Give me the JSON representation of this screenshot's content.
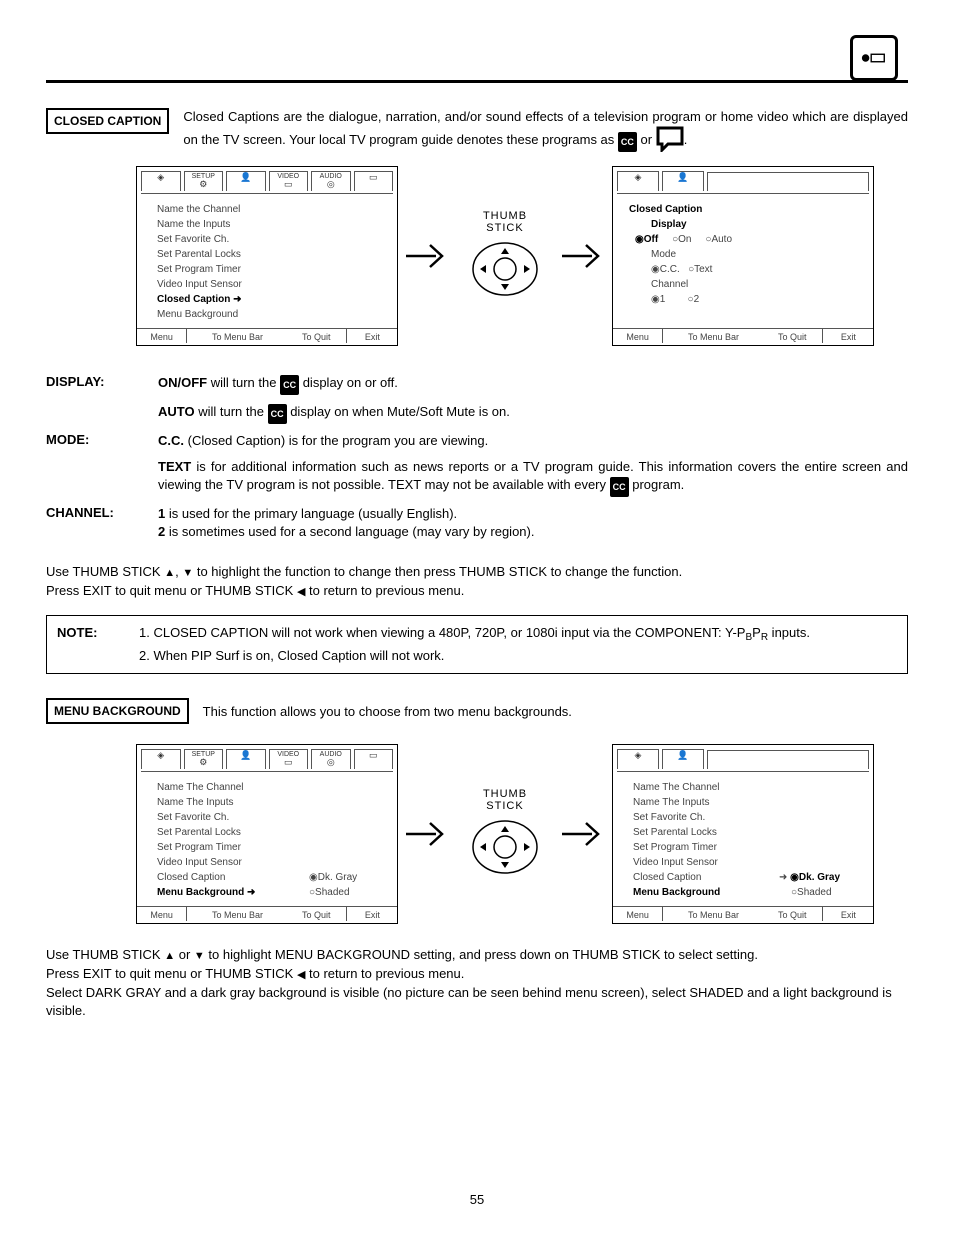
{
  "section1_tag": "CLOSED CAPTION",
  "section1_intro_a": "Closed Captions are the dialogue, narration, and/or sound effects of a television program or home video which are displayed on the TV screen.  Your local TV program guide denotes these programs as ",
  "section1_intro_b": " or ",
  "section1_intro_c": ".",
  "cc": "CC",
  "screen1": {
    "tabs": [
      "SETUP",
      "",
      "VIDEO",
      "AUDIO",
      "",
      ""
    ],
    "items": [
      "Name the Channel",
      "Name the Inputs",
      "Set Favorite Ch.",
      "Set Parental Locks",
      "Set Program Timer",
      "Video Input Sensor",
      "Closed Caption",
      "Menu Background"
    ],
    "footer": [
      "Menu",
      "To Menu Bar",
      "To Quit",
      "Exit"
    ]
  },
  "thumb_label1": "THUMB",
  "thumb_label2": "STICK",
  "screen2": {
    "title": "Closed Caption",
    "group1": "Display",
    "g1": [
      "Off",
      "On",
      "Auto"
    ],
    "group2": "Mode",
    "g2": [
      "C.C.",
      "Text"
    ],
    "group3": "Channel",
    "g3": [
      "1",
      "2"
    ],
    "footer": [
      "Menu",
      "To Menu Bar",
      "To Quit",
      "Exit"
    ]
  },
  "display_label": "DISPLAY:",
  "display_l1a": "ON/OFF",
  "display_l1b": " will turn the ",
  "display_l1c": " display on or off.",
  "display_l2a": "AUTO",
  "display_l2b": " will turn the ",
  "display_l2c": " display on when Mute/Soft Mute is on.",
  "mode_label": "MODE:",
  "mode_l1a": "C.C.",
  "mode_l1b": " (Closed Caption) is for the program you are viewing.",
  "mode_l2a": "TEXT",
  "mode_l2b": " is for additional information such as news reports or a TV program guide.  This information covers the entire screen and viewing the TV program is not possible.  TEXT may not be available with every ",
  "mode_l2c": " program.",
  "channel_label": "CHANNEL:",
  "channel_l1a": "1",
  "channel_l1b": " is used for the primary language (usually English).",
  "channel_l2a": "2",
  "channel_l2b": " is sometimes used for a second language (may vary by region).",
  "inst1a": "Use THUMB STICK ",
  "inst1b": ", ",
  "inst1c": " to highlight the function to change then press THUMB STICK to change the function.",
  "inst2a": "Press EXIT to quit menu or THUMB STICK ",
  "inst2b": " to return to previous menu.",
  "note_hd": "NOTE:",
  "note1a": "1.  CLOSED CAPTION will not work when viewing a 480P, 720P, or 1080i input via the COMPONENT: Y-P",
  "note1b": "B",
  "note1c": "P",
  "note1d": "R",
  "note1e": " inputs.",
  "note2": "2.  When PIP Surf is on, Closed Caption will not work.",
  "section2_tag": "MENU BACKGROUND",
  "section2_intro": "This function allows you to choose from two menu backgrounds.",
  "screen3": {
    "items": [
      "Name The Channel",
      "Name The Inputs",
      "Set Favorite Ch.",
      "Set Parental Locks",
      "Set Program Timer",
      "Video Input Sensor",
      "Closed Caption",
      "Menu Background"
    ],
    "opt1": "Dk. Gray",
    "opt2": "Shaded",
    "footer": [
      "Menu",
      "To Menu Bar",
      "To Quit",
      "Exit"
    ]
  },
  "screen4": {
    "items": [
      "Name The Channel",
      "Name The Inputs",
      "Set Favorite Ch.",
      "Set Parental Locks",
      "Set Program Timer",
      "Video Input Sensor",
      "Closed Caption",
      "Menu Background"
    ],
    "opt1": "Dk. Gray",
    "opt2": "Shaded",
    "footer": [
      "Menu",
      "To Menu Bar",
      "To Quit",
      "Exit"
    ]
  },
  "inst3a": "Use THUMB STICK ",
  "inst3b": " or ",
  "inst3c": " to highlight MENU BACKGROUND setting, and press down on THUMB STICK  to select setting.",
  "inst4a": "Press EXIT to quit menu or THUMB STICK ",
  "inst4b": " to return to previous menu.",
  "inst5": "Select DARK GRAY and a dark gray background is visible (no picture can be seen behind menu screen), select SHADED and a light background is visible.",
  "page_num": "55"
}
